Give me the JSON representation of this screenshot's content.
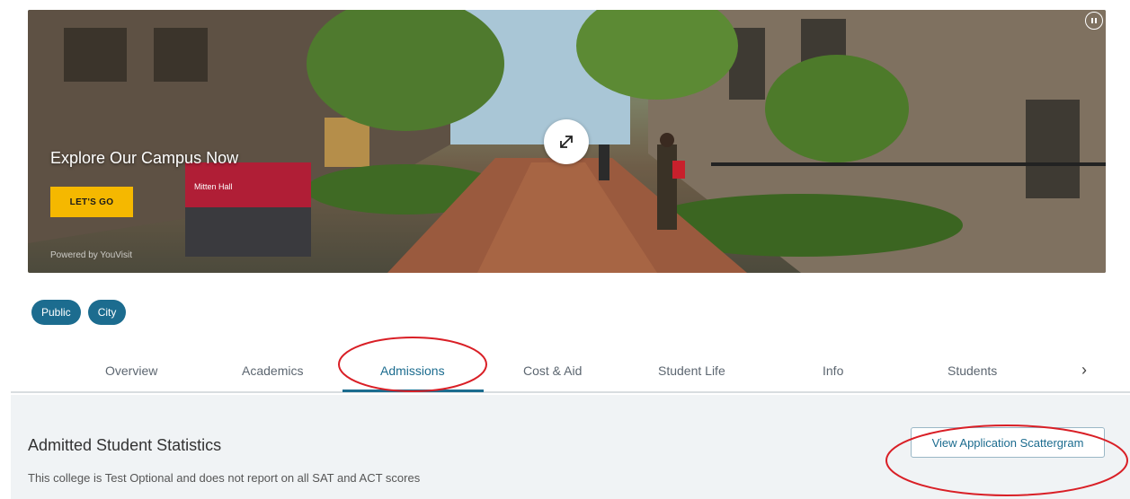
{
  "hero": {
    "title": "Explore Our Campus Now",
    "cta_label": "LET'S GO",
    "powered_by": "Powered by YouVisit",
    "sign_text": "Mitten Hall"
  },
  "tags": [
    {
      "label": "Public"
    },
    {
      "label": "City"
    }
  ],
  "tabs": [
    {
      "label": "Overview"
    },
    {
      "label": "Academics"
    },
    {
      "label": "Admissions",
      "active": true
    },
    {
      "label": "Cost & Aid"
    },
    {
      "label": "Student Life"
    },
    {
      "label": "Info"
    },
    {
      "label": "Students"
    }
  ],
  "tab_next_icon": "chevron-right-icon",
  "section": {
    "title": "Admitted Student Statistics",
    "note": "This college is Test Optional and does not report on all SAT and ACT scores",
    "scatter_button": "View Application Scattergram"
  },
  "colors": {
    "accent": "#1c6c8f",
    "cta": "#f5b800",
    "annotation": "#d91f26",
    "section_bg": "#f0f3f5"
  }
}
